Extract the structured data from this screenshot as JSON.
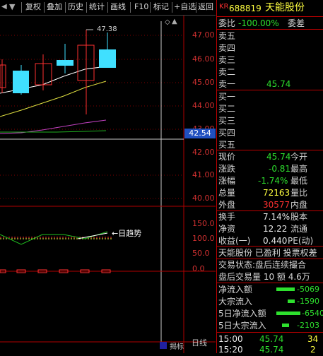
{
  "toolbar": {
    "items": [
      "复权",
      "叠加",
      "历史",
      "统计",
      "画线",
      "F10",
      "标记",
      "+自选",
      "返回"
    ]
  },
  "chart": {
    "max_label": "47.38",
    "price_labels": [
      "47.00",
      "46.00",
      "45.00",
      "44.00",
      "43.00",
      "42.00",
      "41.00",
      "40.00"
    ],
    "current_price_tag": "42.54",
    "indicator_labels": [
      "150.0",
      "100.0",
      "50.0",
      "0.0"
    ],
    "legend": "←日趋势",
    "bottom_tabs": [
      "揭标",
      "日线"
    ],
    "scroll_arrow": "▲"
  },
  "stock": {
    "kr_badge": "KR",
    "code": "688819",
    "name": "天能股份"
  },
  "orderbook": {
    "weibi_label": "委比",
    "weibi_value": "-100.00%",
    "weicha_label": "委差",
    "sells": [
      {
        "label": "卖五",
        "price": "",
        "vol": ""
      },
      {
        "label": "卖四",
        "price": "",
        "vol": ""
      },
      {
        "label": "卖三",
        "price": "",
        "vol": ""
      },
      {
        "label": "卖二",
        "price": "",
        "vol": ""
      },
      {
        "label": "卖一",
        "price": "45.74",
        "vol": ""
      }
    ],
    "buys": [
      {
        "label": "买一",
        "price": "",
        "vol": ""
      },
      {
        "label": "买二",
        "price": "",
        "vol": ""
      },
      {
        "label": "买三",
        "price": "",
        "vol": ""
      },
      {
        "label": "买四",
        "price": "",
        "vol": ""
      },
      {
        "label": "买五",
        "price": "",
        "vol": ""
      }
    ]
  },
  "stats": {
    "xianjia": {
      "label": "现价",
      "value": "45.74"
    },
    "jinkai": {
      "label": "今开",
      "value": ""
    },
    "zhangdie": {
      "label": "涨跌",
      "value": "-0.81"
    },
    "zuigao": {
      "label": "最高",
      "value": ""
    },
    "zhangfu": {
      "label": "涨幅",
      "value": "-1.74%"
    },
    "zuidi": {
      "label": "最低",
      "value": ""
    },
    "zongliang": {
      "label": "总量",
      "value": "72163"
    },
    "liangbi": {
      "label": "量比",
      "value": ""
    },
    "waipan": {
      "label": "外盘",
      "value": "30577"
    },
    "neipan": {
      "label": "内盘",
      "value": ""
    },
    "huanshou": {
      "label": "换手",
      "value": "7.14%"
    },
    "guben": {
      "label": "股本",
      "value": ""
    },
    "jingzi": {
      "label": "净资",
      "value": "12.22"
    },
    "liutong": {
      "label": "流通",
      "value": ""
    },
    "shouyi": {
      "label": "收益(一)",
      "value": "0.440"
    },
    "pe": {
      "label": "PE(动)",
      "value": ""
    }
  },
  "info": {
    "line1": "天能股份 已盈利 投票权差",
    "line2": "交易状态:盘后连续撮合",
    "line3": "盘后交易量 10 额 4.6万"
  },
  "flows": [
    {
      "label": "净流入额",
      "value": "-5069"
    },
    {
      "label": "大宗流入",
      "value": "-1590"
    },
    {
      "label": "5日净流入额",
      "value": "-6540"
    },
    {
      "label": "5日大宗流入",
      "value": "-2103"
    }
  ],
  "ticks": [
    {
      "time": "15:00",
      "price": "45.74",
      "vol": "34"
    },
    {
      "time": "15:20",
      "price": "45.74",
      "vol": "2"
    }
  ],
  "colors": {
    "up": "#ff3030",
    "down": "#40e0ff",
    "ma_white": "#ffffff",
    "ma_yellow": "#ffff40",
    "ma_purple": "#c040c0",
    "ma_green": "#20c020",
    "grid_red": "#b00000"
  }
}
